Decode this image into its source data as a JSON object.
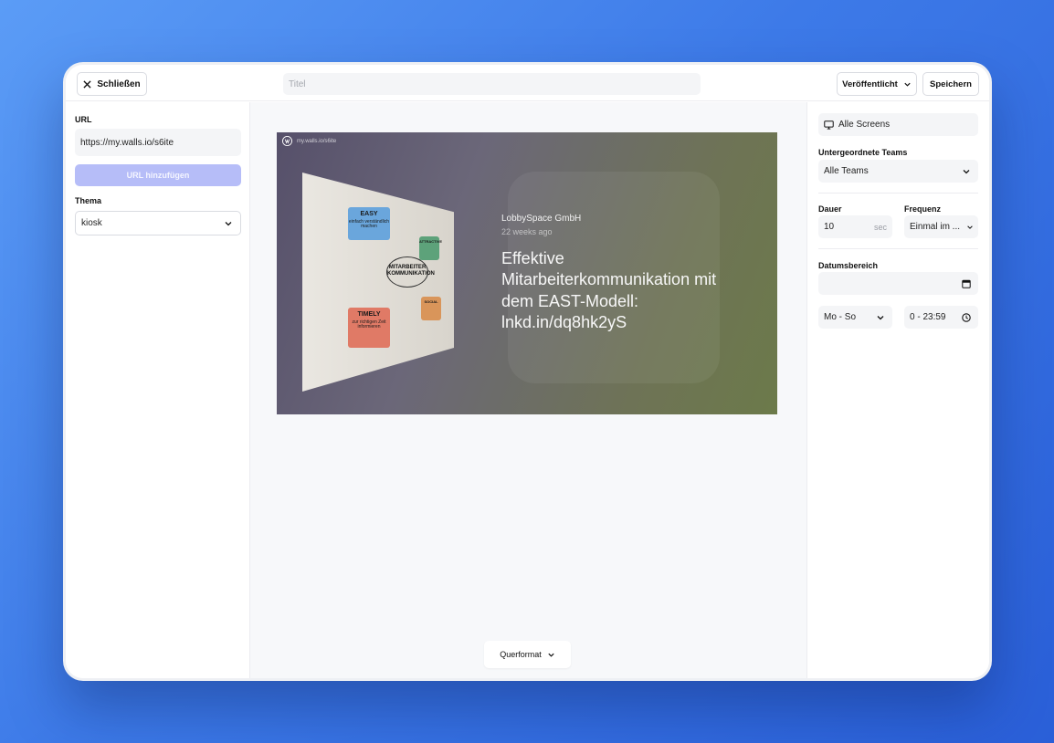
{
  "topbar": {
    "close_label": "Schließen",
    "title_placeholder": "Titel",
    "publish_label": "Veröffentlicht",
    "save_label": "Speichern"
  },
  "left": {
    "url_label": "URL",
    "url_value": "https://my.walls.io/s6ite",
    "add_url_label": "URL hinzufügen",
    "theme_label": "Thema",
    "theme_value": "kiosk"
  },
  "preview": {
    "source": "my.walls.io/s6ite",
    "author": "LobbySpace GmbH",
    "time": "22 weeks ago",
    "text": "Effektive Mitarbeiterkommunikation mit dem EAST-Modell: lnkd.in/dq8hk2yS",
    "board": {
      "easy_title": "EASY",
      "easy_sub": "einfach verständlich machen",
      "attractive_title": "ATTRACTIVE",
      "center": "MITARBEITER KOMMUNIKATION",
      "social_title": "SOCIAL",
      "timely_title": "TIMELY",
      "timely_sub": "zur richtigen Zeit informieren"
    },
    "format_label": "Querformat"
  },
  "right": {
    "screens_label": "Alle Screens",
    "subteams_label": "Untergeordnete Teams",
    "subteams_value": "Alle Teams",
    "duration_label": "Dauer",
    "duration_value": "10",
    "duration_unit": "sec",
    "frequency_label": "Frequenz",
    "frequency_value": "Einmal im ...",
    "daterange_label": "Datumsbereich",
    "days_value": "Mo - So",
    "time_value": "0 - 23:59"
  },
  "colors": {
    "accent_disabled": "#b6bdf8",
    "background_gradient_start": "#5b9cf6",
    "background_gradient_end": "#2a5fd8"
  }
}
